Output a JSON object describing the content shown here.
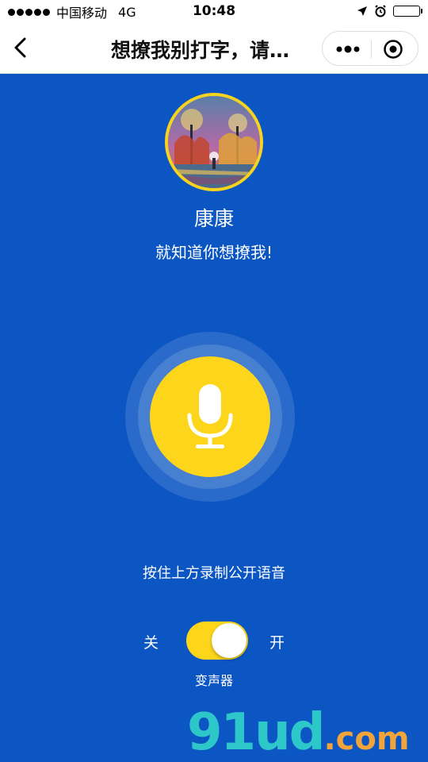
{
  "status_bar": {
    "carrier": "中国移动",
    "network": "4G",
    "time": "10:48"
  },
  "nav": {
    "title": "想撩我别打字，请…"
  },
  "profile": {
    "nickname": "康康",
    "tagline": "就知道你想撩我!"
  },
  "recorder": {
    "hint": "按住上方录制公开语音"
  },
  "voice_changer": {
    "off_label": "关",
    "on_label": "开",
    "caption": "变声器",
    "enabled": true
  },
  "watermark": {
    "main": "91ud",
    "suffix": ".com"
  },
  "colors": {
    "background": "#0c56c3",
    "accent_yellow": "#fdd61b",
    "watermark_teal": "#2ec7c9",
    "watermark_orange": "#f1a43a"
  },
  "icons": {
    "back": "chevron-left-icon",
    "more": "more-dots-icon",
    "close": "target-close-icon",
    "mic": "microphone-icon",
    "location": "location-arrow-icon",
    "alarm": "alarm-icon",
    "battery": "battery-icon"
  }
}
